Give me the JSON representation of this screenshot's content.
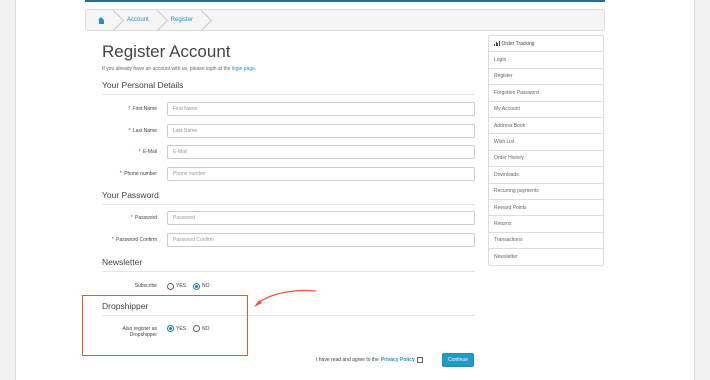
{
  "breadcrumb": {
    "items": [
      "Account",
      "Register"
    ]
  },
  "page": {
    "title": "Register Account",
    "intro_prefix": "If you already have an account with us, please login at the ",
    "intro_link": "login page",
    "intro_suffix": "."
  },
  "personal": {
    "legend": "Your Personal Details",
    "fields": [
      {
        "label": "First Name",
        "placeholder": "First Name"
      },
      {
        "label": "Last Name",
        "placeholder": "Last Name"
      },
      {
        "label": "E-Mail",
        "placeholder": "E-Mail"
      },
      {
        "label": "Phone number",
        "placeholder": "Phone number"
      }
    ]
  },
  "password": {
    "legend": "Your Password",
    "fields": [
      {
        "label": "Password",
        "placeholder": "Password"
      },
      {
        "label": "Password Confirm",
        "placeholder": "Password Confirm"
      }
    ]
  },
  "newsletter": {
    "legend": "Newsletter",
    "label": "Subscribe",
    "yes": "YES",
    "no": "NO",
    "selected": "NO"
  },
  "dropshipper": {
    "legend": "Dropshipper",
    "label": "Also register as Dropshipper",
    "yes": "YES",
    "no": "NO",
    "selected": "YES"
  },
  "footer": {
    "agree_prefix": "I have read and agree to the ",
    "agree_link": "Privacy Policy",
    "continue": "Continue"
  },
  "sidebar": {
    "items": [
      "Order Tracking",
      "Login",
      "Register",
      "Forgotten Password",
      "My Account",
      "Address Book",
      "Wish List",
      "Order History",
      "Downloads",
      "Recurring payments",
      "Reward Points",
      "Returns",
      "Transactions",
      "Newsletter"
    ]
  },
  "colors": {
    "accent": "#1e91cf",
    "button": "#229ac8",
    "highlight": "#f0552f",
    "required": "#e02020"
  }
}
